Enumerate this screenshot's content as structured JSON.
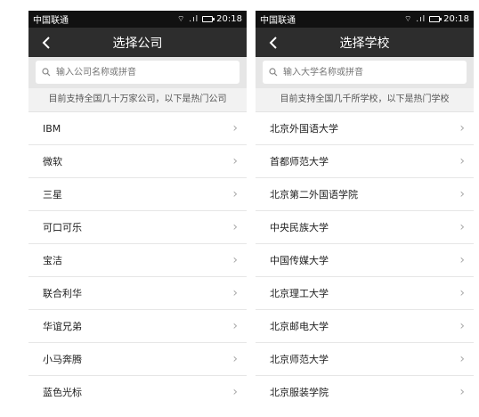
{
  "status": {
    "carrier": "中国联通",
    "time": "20:18",
    "signal_icons": "⌔ .ıl"
  },
  "left": {
    "title": "选择公司",
    "search_placeholder": "输入公司名称或拼音",
    "hint": "目前支持全国几十万家公司，以下是热门公司",
    "items": [
      "IBM",
      "微软",
      "三星",
      "可口可乐",
      "宝洁",
      "联合利华",
      "华谊兄弟",
      "小马奔腾",
      "蓝色光标"
    ]
  },
  "right": {
    "title": "选择学校",
    "search_placeholder": "输入大学名称或拼音",
    "hint": "目前支持全国几千所学校，以下是热门学校",
    "items": [
      "北京外国语大学",
      "首都师范大学",
      "北京第二外国语学院",
      "中央民族大学",
      "中国传媒大学",
      "北京理工大学",
      "北京邮电大学",
      "北京师范大学",
      "北京服装学院"
    ]
  },
  "icons": {
    "back": "chevron-left-icon",
    "search": "search-icon",
    "chevron": "chevron-right-icon"
  }
}
